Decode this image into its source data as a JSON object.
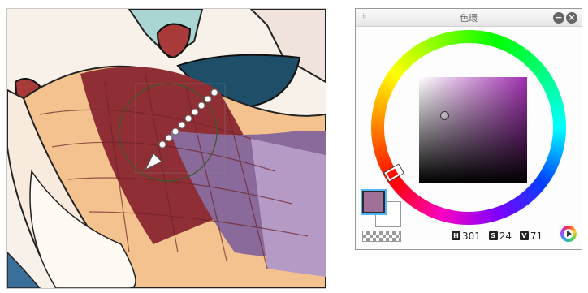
{
  "canvas": {
    "description_name": "illustration"
  },
  "panel": {
    "title": "色環",
    "menu_glyph": "⊧",
    "minimize_glyph": "−",
    "close_glyph": "×"
  },
  "colors": {
    "foreground": "#a07098",
    "background": "#ffffff",
    "hue_square": "#a030b0"
  },
  "hsv": {
    "h_label": "H",
    "h_value": "301",
    "s_label": "S",
    "s_value": "24",
    "v_label": "V",
    "v_value": "71"
  }
}
